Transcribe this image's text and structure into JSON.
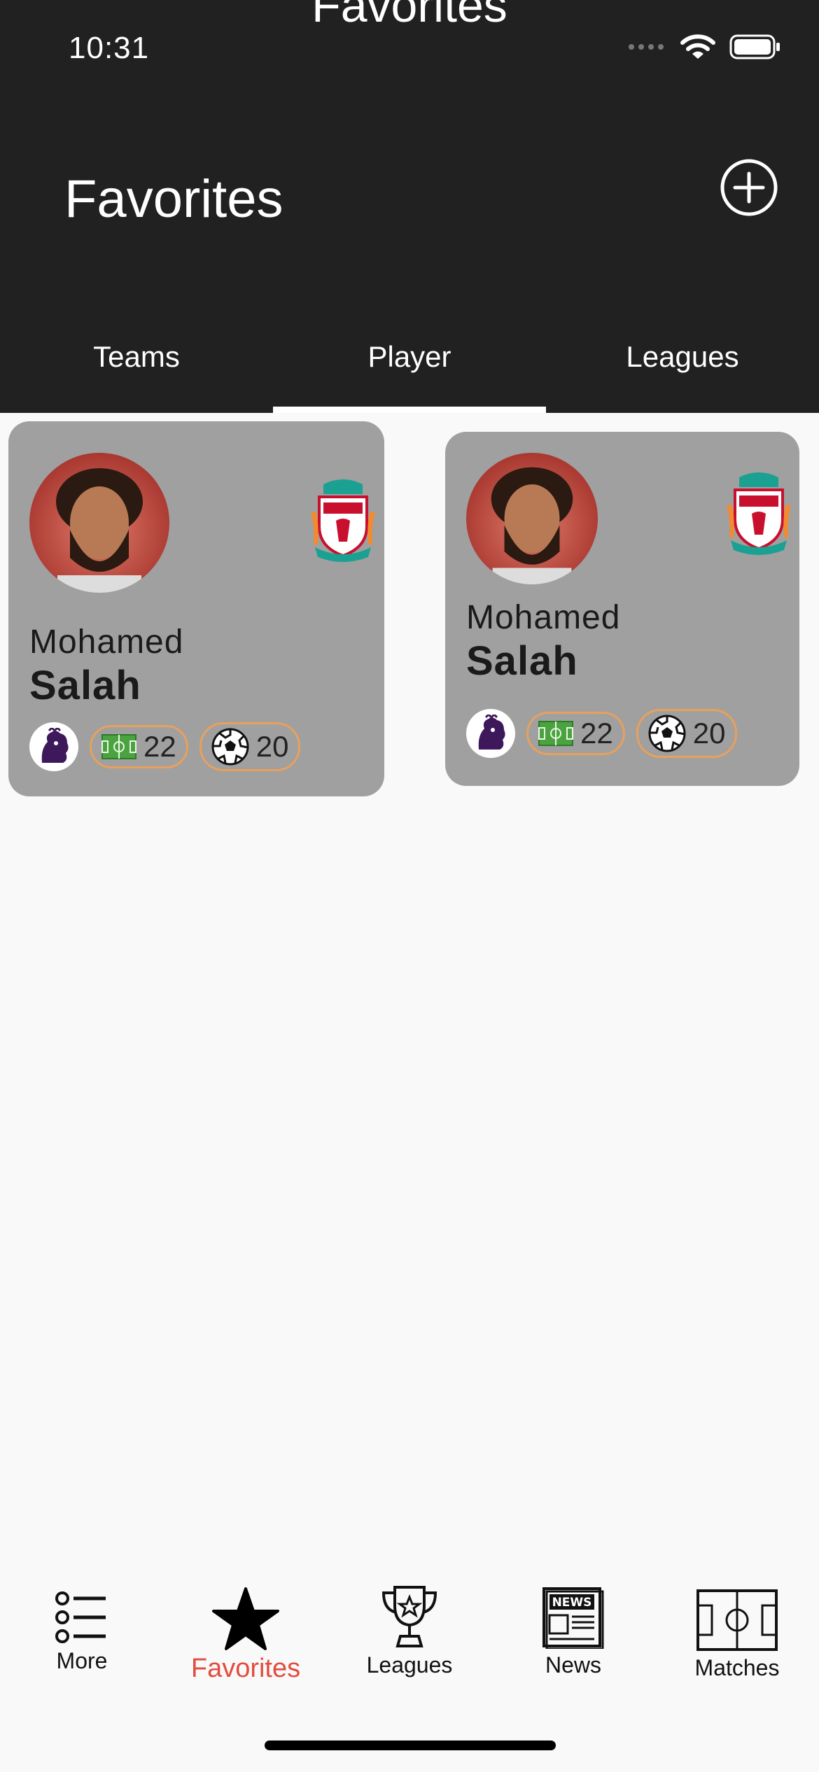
{
  "status_bar": {
    "time": "10:31"
  },
  "header": {
    "large_title_peek": "Favorites",
    "title": "Favorites"
  },
  "tabs": [
    {
      "label": "Teams",
      "active": false
    },
    {
      "label": "Player",
      "active": true
    },
    {
      "label": "Leagues",
      "active": false
    }
  ],
  "cards": [
    {
      "first_name": "Mohamed",
      "last_name": "Salah",
      "appearances": "22",
      "goals": "20"
    },
    {
      "first_name": "Mohamed",
      "last_name": "Salah",
      "appearances": "22",
      "goals": "20"
    }
  ],
  "tabbar": {
    "items": [
      {
        "label": "More",
        "icon": "list-icon"
      },
      {
        "label": "Favorites",
        "icon": "star-icon",
        "active": true
      },
      {
        "label": "Leagues",
        "icon": "trophy-icon"
      },
      {
        "label": "News",
        "icon": "newspaper-icon"
      },
      {
        "label": "Matches",
        "icon": "pitch-icon"
      }
    ]
  },
  "colors": {
    "header_bg": "#212121",
    "card_bg": "#a0a0a0",
    "pill_border": "#e8a05c",
    "active_tab": "#e24c3f"
  }
}
